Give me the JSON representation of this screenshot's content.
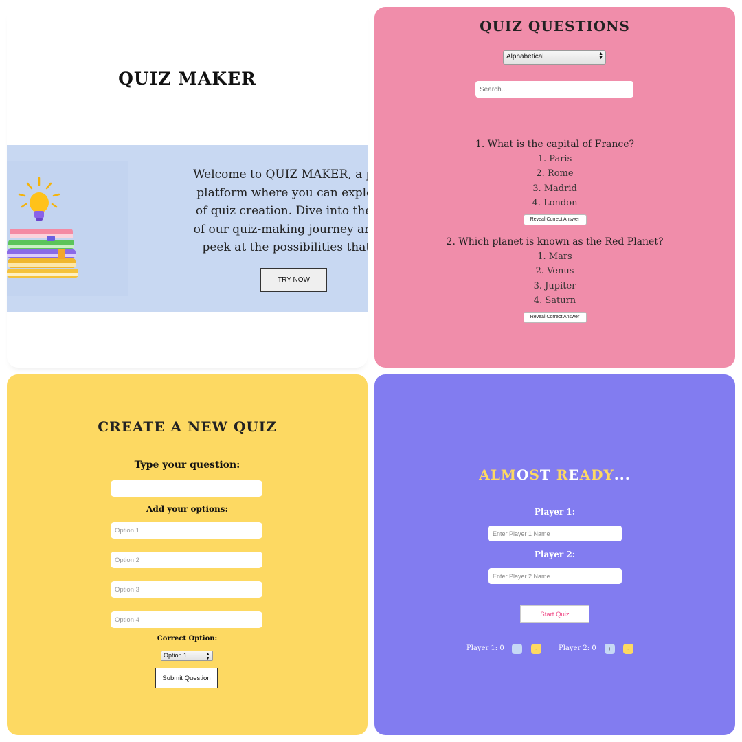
{
  "colors": {
    "panel_hero": "#ffffff",
    "panel_questions": "#f08daa",
    "panel_create": "#fdd962",
    "panel_ready": "#827cf0",
    "accent_yellow": "#fdd962",
    "start_text": "#f0508a"
  },
  "hero": {
    "title": "QUIZ MAKER",
    "illustration": "books-lightbulb-image",
    "intro_lines": [
      "Welcome to QUIZ MAKER, a proto",
      "platform where you can explore t",
      "of quiz creation. Dive into the ear",
      "of our quiz-making journey and ge",
      "peek at the possibilities that lie"
    ],
    "try_button": "TRY NOW"
  },
  "questions": {
    "title": "QUIZ QUESTIONS",
    "sort_value": "Alphabetical",
    "search_placeholder": "Search...",
    "items": [
      {
        "question": "1. What is the capital of France?",
        "options": [
          "1. Paris",
          "2. Rome",
          "3. Madrid",
          "4. London"
        ],
        "reveal_label": "Reveal Correct Answer"
      },
      {
        "question": "2. Which planet is known as the Red Planet?",
        "options": [
          "1. Mars",
          "2. Venus",
          "3. Jupiter",
          "4. Saturn"
        ],
        "reveal_label": "Reveal Correct Answer"
      }
    ]
  },
  "create": {
    "title": "CREATE A NEW QUIZ",
    "question_label": "Type your question:",
    "question_value": "",
    "options_label": "Add your options:",
    "option_placeholders": [
      "Option 1",
      "Option 2",
      "Option 3",
      "Option 4"
    ],
    "correct_label": "Correct Option:",
    "correct_value": "Option 1",
    "submit_label": "Submit Question"
  },
  "ready": {
    "title_letters": [
      {
        "ch": "A",
        "color": "#fdd962"
      },
      {
        "ch": "L",
        "color": "#fdd962"
      },
      {
        "ch": "M",
        "color": "#fdd962"
      },
      {
        "ch": "O",
        "color": "#ffffff"
      },
      {
        "ch": "S",
        "color": "#fdd962"
      },
      {
        "ch": "T",
        "color": "#ffffff"
      },
      {
        "ch": " ",
        "color": "#ffffff"
      },
      {
        "ch": "R",
        "color": "#fdd962"
      },
      {
        "ch": "E",
        "color": "#ffffff"
      },
      {
        "ch": "A",
        "color": "#fdd962"
      },
      {
        "ch": "D",
        "color": "#fdd962"
      },
      {
        "ch": "Y",
        "color": "#fdd962"
      },
      {
        "ch": ".",
        "color": "#ffffff"
      },
      {
        "ch": ".",
        "color": "#ffffff"
      },
      {
        "ch": ".",
        "color": "#ffffff"
      }
    ],
    "player1_label": "Player 1:",
    "player1_placeholder": "Enter Player 1 Name",
    "player2_label": "Player 2:",
    "player2_placeholder": "Enter Player 2 Name",
    "start_label": "Start Quiz",
    "score1_label": "Player 1:",
    "score1_value": "0",
    "score2_label": "Player 2:",
    "score2_value": "0",
    "plus_symbol": "+",
    "minus_symbol": "-"
  }
}
